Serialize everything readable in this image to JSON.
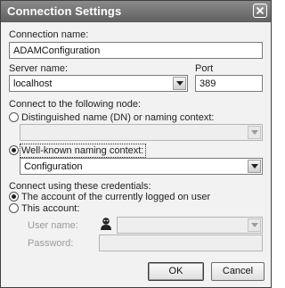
{
  "window": {
    "title": "Connection Settings"
  },
  "connection_name": {
    "label": "Connection name:",
    "value": "ADAMConfiguration"
  },
  "server": {
    "label": "Server name:",
    "value": "localhost"
  },
  "port": {
    "label": "Port",
    "value": "389"
  },
  "node": {
    "label": "Connect to the following node:",
    "dn_option": {
      "label": "Distinguished name (DN) or naming context:",
      "selected": false,
      "value": ""
    },
    "well_known_option": {
      "label": "Well-known naming context:",
      "selected": true,
      "value": "Configuration"
    }
  },
  "credentials": {
    "label": "Connect using these credentials:",
    "current_user_option": {
      "label": "The account of the currently logged on user",
      "selected": true
    },
    "this_account_option": {
      "label": "This account:",
      "selected": false
    },
    "user_name": {
      "label": "User name:",
      "value": ""
    },
    "password": {
      "label": "Password:",
      "value": ""
    }
  },
  "buttons": {
    "ok": "OK",
    "cancel": "Cancel"
  },
  "icons": {
    "close": "close-icon",
    "user": "user-icon",
    "dropdown": "chevron-down-icon"
  }
}
